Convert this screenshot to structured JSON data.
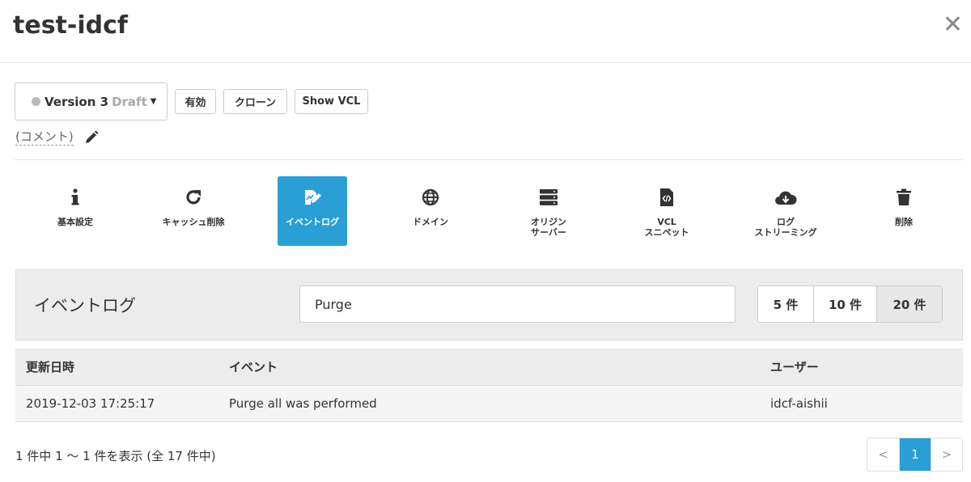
{
  "window": {
    "title": "test-idcf",
    "close_glyph": "✕"
  },
  "version": {
    "name": "Version 3",
    "state": "Draft"
  },
  "toolbar": {
    "activate": "有効",
    "clone": "クローン",
    "show_vcl": "Show VCL"
  },
  "comment": {
    "label": "(コメント)"
  },
  "nav": {
    "items": [
      {
        "label": "基本設定",
        "icon": "info-icon"
      },
      {
        "label": "キャッシュ削除",
        "icon": "refresh-icon"
      },
      {
        "label": "イベントログ",
        "icon": "edit-log-icon",
        "active": true
      },
      {
        "label": "ドメイン",
        "icon": "globe-icon"
      },
      {
        "label": "オリジン\nサーバー",
        "icon": "server-icon"
      },
      {
        "label": "VCL\nスニペット",
        "icon": "code-file-icon"
      },
      {
        "label": "ログ\nストリーミング",
        "icon": "cloud-download-icon"
      },
      {
        "label": "削除",
        "icon": "trash-icon"
      }
    ]
  },
  "eventlog": {
    "title": "イベントログ",
    "search_value": "Purge",
    "page_sizes": [
      "5 件",
      "10 件",
      "20 件"
    ],
    "selected_page_size": "20 件"
  },
  "table": {
    "headers": [
      "更新日時",
      "イベント",
      "ユーザー"
    ],
    "rows": [
      [
        "2019-12-03 17:25:17",
        "Purge all was performed",
        "idcf-aishii"
      ]
    ]
  },
  "summary": "1 件中 1 〜 1 件を表示 (全 17 件中)",
  "pagination": {
    "prev": "<",
    "current": "1",
    "next": ">"
  },
  "colors": {
    "accent": "#2a9fd6"
  }
}
